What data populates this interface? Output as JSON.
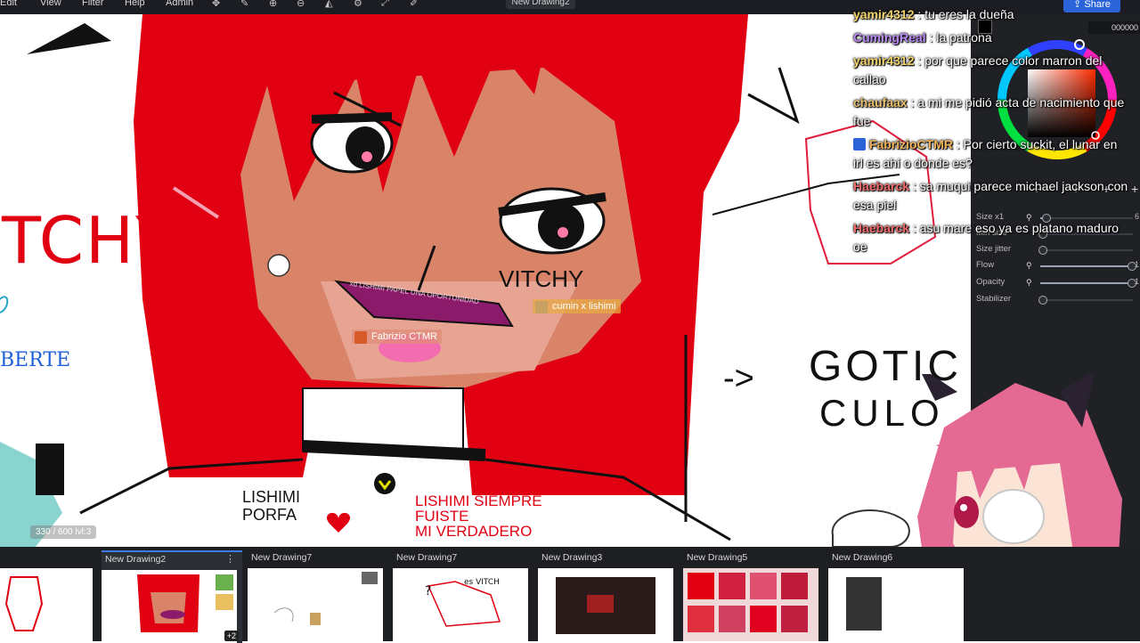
{
  "app": {
    "menu": [
      "Edit",
      "View",
      "Filter",
      "Help",
      "Admin"
    ],
    "document_tab": "New Drawing2",
    "share_label": "Share"
  },
  "canvas": {
    "cursors": [
      {
        "name": "cumin x lishimi",
        "color": "#e8aa46"
      },
      {
        "name": "Fabrizio CTMR",
        "color": "#e08c78"
      }
    ],
    "zoom_readout": "330 / 600  lvl:3",
    "texts": {
      "left_tchy": "TCHY",
      "left_berte": "BERTE",
      "gotic": "GOTIC",
      "culo": "CULO",
      "arrow": "->",
      "lishimi_porfa": "LISHIMI\nPORFA",
      "lishimi_siempre": "LISHIMI SIEMPRE\nFUISTE\nMI VERDADERO",
      "vitchy": "VITCHY",
      "mouth_text": "xd LISHIMI PAPEL UNA OPORTUNIDAD"
    }
  },
  "right_panel": {
    "hex_value": "000000",
    "sliders": [
      {
        "label": "Size x1",
        "value": "6",
        "fraction": 0.03,
        "locked": true
      },
      {
        "label": "Min size",
        "value": "",
        "fraction": 0.0,
        "locked": false
      },
      {
        "label": "Size jitter",
        "value": "",
        "fraction": 0.0,
        "locked": false
      },
      {
        "label": "Flow",
        "value": "1",
        "fraction": 1.0,
        "locked": true
      },
      {
        "label": "Opacity",
        "value": "1",
        "fraction": 1.0,
        "locked": true
      },
      {
        "label": "Stabilizer",
        "value": "",
        "fraction": 0.0,
        "locked": false
      }
    ]
  },
  "chat": [
    {
      "user": "yamir4312",
      "color": "#f2d36b",
      "text": "tu eres la dueña"
    },
    {
      "user": "CumingReal",
      "color": "#b98af5",
      "text": "la patrona"
    },
    {
      "user": "yamir4312",
      "color": "#f2d36b",
      "text": "por que parece color marron del callao"
    },
    {
      "user": "chaufaax",
      "color": "#e8c06c",
      "text": "a mi me pidió acta de nacimiento que fue"
    },
    {
      "user": "FabrizioCTMR",
      "color": "#f2b45a",
      "text": "Por cierto suckit, el lunar en irl es ahí o donde es?"
    },
    {
      "user": "Haebarck",
      "color": "#f06b6b",
      "text": "sa muqui parece michael jackson con esa piel"
    },
    {
      "user": "Haebarck",
      "color": "#f06b6b",
      "text": "asu mare eso ya es platano maduro oe"
    }
  ],
  "drawings": [
    {
      "title": "",
      "active": false
    },
    {
      "title": "New Drawing2",
      "active": true,
      "extra": "+2"
    },
    {
      "title": "New Drawing7",
      "active": false
    },
    {
      "title": "New Drawing7",
      "active": false
    },
    {
      "title": "New Drawing3",
      "active": false
    },
    {
      "title": "New Drawing5",
      "active": false
    },
    {
      "title": "New Drawing6",
      "active": false
    }
  ],
  "icons": [
    "move-icon",
    "brush-icon",
    "zoom-in-icon",
    "zoom-out-icon",
    "flip-icon",
    "settings-icon",
    "expand-icon",
    "eyedropper-icon",
    "more-icon"
  ],
  "colors": {
    "accent": "#2b63d9",
    "panel": "#1f2125",
    "hair_red": "#e00012",
    "skin": "#d98468"
  }
}
